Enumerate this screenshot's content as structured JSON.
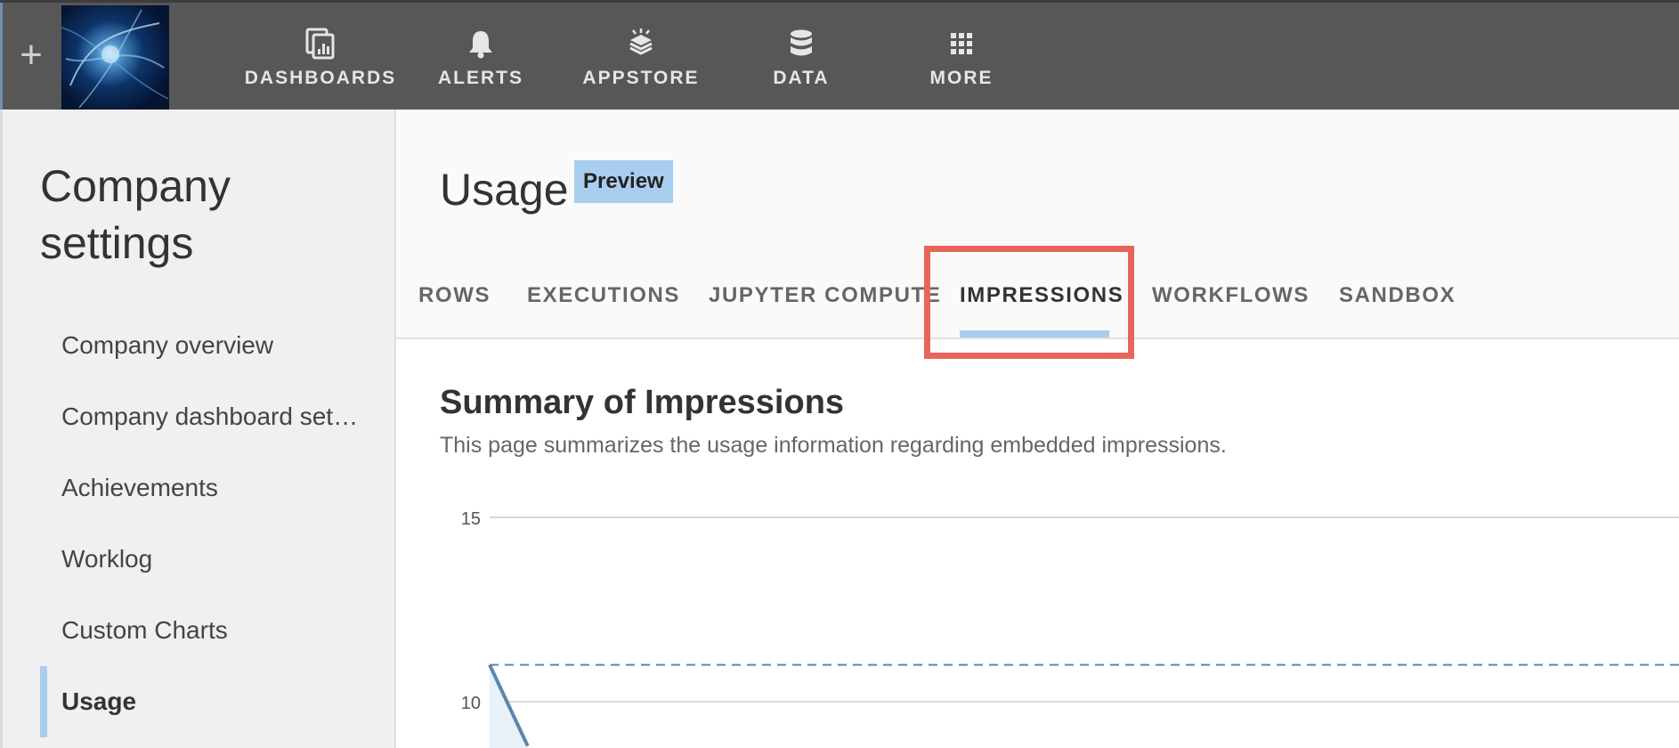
{
  "nav": {
    "items": [
      {
        "label": "DASHBOARDS",
        "icon": "dashboards-icon"
      },
      {
        "label": "ALERTS",
        "icon": "bell-icon"
      },
      {
        "label": "APPSTORE",
        "icon": "appstore-icon"
      },
      {
        "label": "DATA",
        "icon": "database-icon"
      },
      {
        "label": "MORE",
        "icon": "grid-icon"
      }
    ],
    "plus": "+"
  },
  "sidebar": {
    "title": "Company settings",
    "items": [
      {
        "label": "Company overview"
      },
      {
        "label": "Company dashboard settings"
      },
      {
        "label": "Achievements"
      },
      {
        "label": "Worklog"
      },
      {
        "label": "Custom Charts"
      },
      {
        "label": "Usage",
        "active": true
      }
    ]
  },
  "main": {
    "title": "Usage",
    "badge": "Preview",
    "tabs": [
      {
        "label": "ROWS"
      },
      {
        "label": "EXECUTIONS"
      },
      {
        "label": "JUPYTER COMPUTE"
      },
      {
        "label": "IMPRESSIONS",
        "active": true
      },
      {
        "label": "WORKFLOWS"
      },
      {
        "label": "SANDBOX"
      }
    ],
    "section_title": "Summary of Impressions",
    "section_subtitle": "This page summarizes the usage information regarding embedded impressions."
  },
  "chart_data": {
    "type": "line",
    "ytick_labels": [
      "15",
      "10"
    ],
    "yticks": [
      15,
      10
    ],
    "ylim": [
      8.8,
      15
    ],
    "reference_line": 11.0,
    "series": [
      {
        "x": [
          0,
          0.032
        ],
        "values": [
          11.0,
          8.8
        ]
      }
    ],
    "grid": true,
    "colors": {
      "line": "#5b86ad",
      "grid": "#d8d8d8",
      "reference": "#5b86ad"
    }
  },
  "colors": {
    "topbar": "#575757",
    "accent": "#a9cdee",
    "highlight": "#e8655a",
    "sidebar_bg": "#f0f0f0"
  }
}
